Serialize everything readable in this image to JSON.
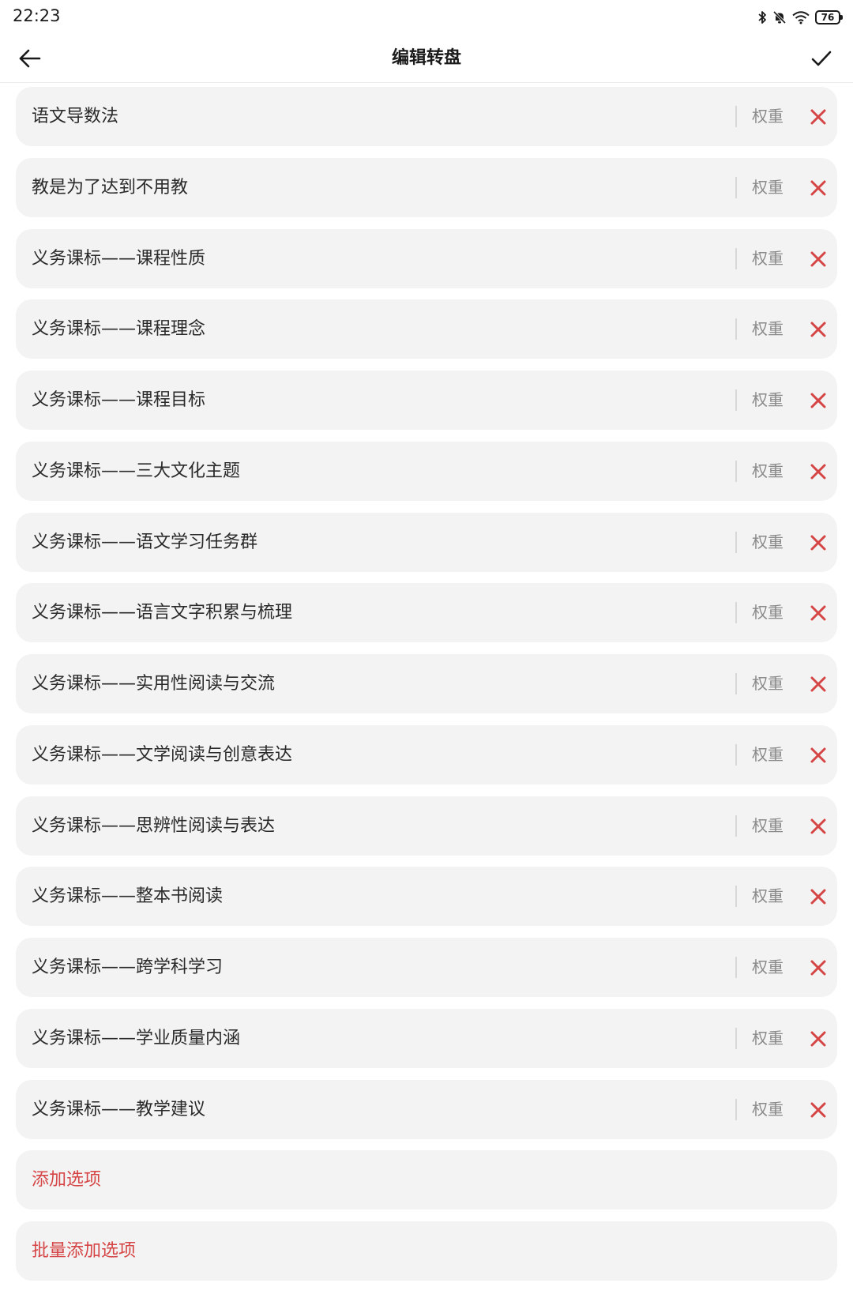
{
  "status_bar": {
    "time": "22:23",
    "battery": "76"
  },
  "app_bar": {
    "title": "编辑转盘"
  },
  "options": [
    {
      "label": "语文导数法",
      "weight": "权重"
    },
    {
      "label": "教是为了达到不用教",
      "weight": "权重"
    },
    {
      "label": "义务课标——课程性质",
      "weight": "权重"
    },
    {
      "label": "义务课标——课程理念",
      "weight": "权重"
    },
    {
      "label": "义务课标——课程目标",
      "weight": "权重"
    },
    {
      "label": "义务课标——三大文化主题",
      "weight": "权重"
    },
    {
      "label": "义务课标——语文学习任务群",
      "weight": "权重"
    },
    {
      "label": "义务课标——语言文字积累与梳理",
      "weight": "权重"
    },
    {
      "label": "义务课标——实用性阅读与交流",
      "weight": "权重"
    },
    {
      "label": "义务课标——文学阅读与创意表达",
      "weight": "权重"
    },
    {
      "label": "义务课标——思辨性阅读与表达",
      "weight": "权重"
    },
    {
      "label": "义务课标——整本书阅读",
      "weight": "权重"
    },
    {
      "label": "义务课标——跨学科学习",
      "weight": "权重"
    },
    {
      "label": "义务课标——学业质量内涵",
      "weight": "权重"
    },
    {
      "label": "义务课标——教学建议",
      "weight": "权重"
    }
  ],
  "actions": {
    "add_option": "添加选项",
    "batch_add_option": "批量添加选项"
  },
  "colors": {
    "accent": "#d64545",
    "row_background": "#f3f3f3"
  },
  "icons": {
    "back": "arrow-left-icon",
    "confirm": "checkmark-icon",
    "delete": "close-icon",
    "bluetooth": "bluetooth-icon",
    "mute": "bell-off-icon",
    "wifi": "wifi-icon",
    "battery": "battery-icon"
  }
}
